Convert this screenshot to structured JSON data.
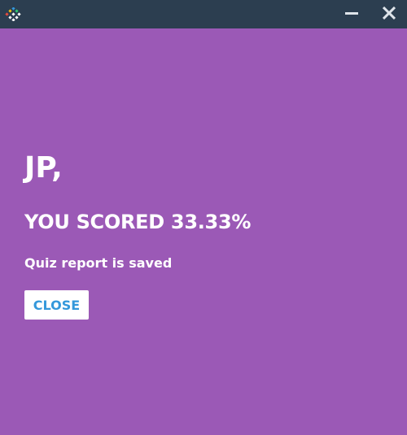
{
  "titlebar": {
    "app_icon": "app-logo-icon",
    "minimize_icon": "minimize-icon",
    "close_icon": "close-icon"
  },
  "result": {
    "greeting": "JP,",
    "score_text": "YOU SCORED 33.33%",
    "status_text": "Quiz report is saved",
    "close_label": "CLOSE"
  },
  "colors": {
    "background": "#9b59b6",
    "titlebar": "#2c3e50",
    "button_text": "#3498db",
    "text": "#ffffff"
  }
}
